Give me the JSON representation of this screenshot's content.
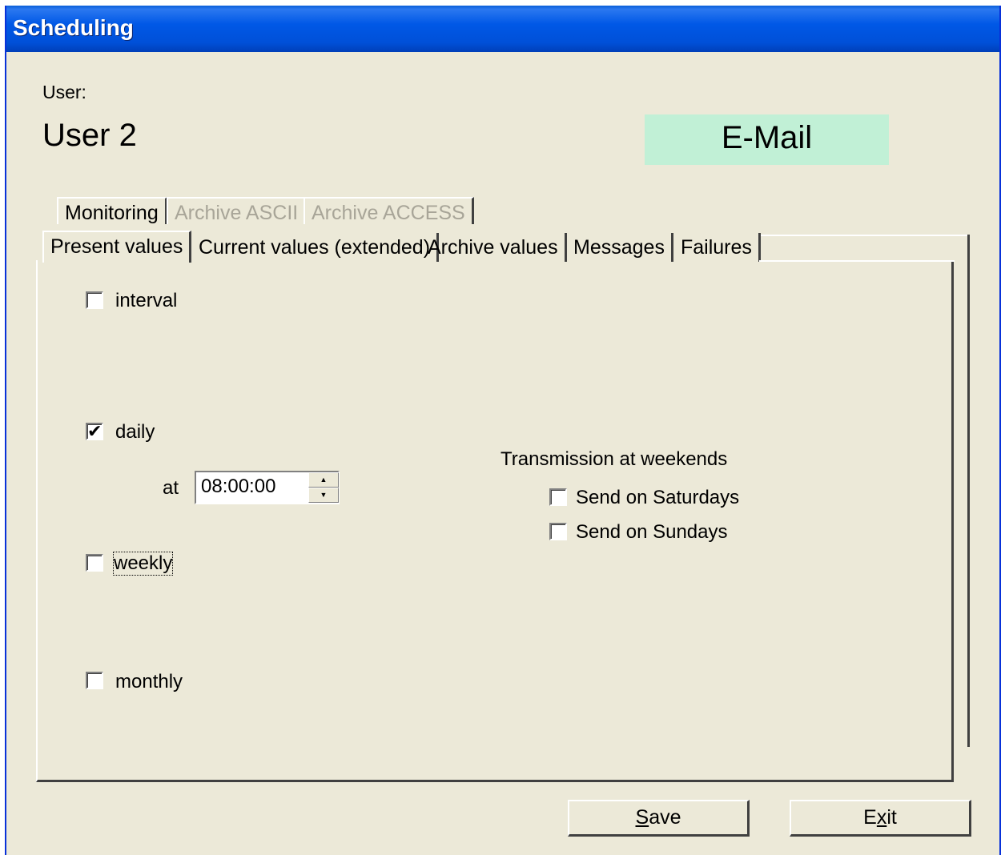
{
  "window": {
    "title": "Scheduling"
  },
  "user": {
    "label": "User:",
    "name": "User 2"
  },
  "channel": {
    "label": "E-Mail",
    "color": "#c1f0d6"
  },
  "tabs_row1": [
    {
      "label": "Monitoring",
      "disabled": false
    },
    {
      "label": "Archive ASCII",
      "disabled": true
    },
    {
      "label": "Archive ACCESS",
      "disabled": true
    }
  ],
  "tabs_row2": [
    {
      "label": "Present values",
      "active": true
    },
    {
      "label": "Current values (extended)"
    },
    {
      "label": "Archive values"
    },
    {
      "label": "Messages"
    },
    {
      "label": "Failures"
    }
  ],
  "schedule": {
    "interval": {
      "label": "interval",
      "checked": false
    },
    "daily": {
      "label": "daily",
      "checked": true,
      "at_label": "at",
      "time": "08:00:00"
    },
    "weekly": {
      "label": "weekly",
      "checked": false
    },
    "monthly": {
      "label": "monthly",
      "checked": false
    }
  },
  "weekends": {
    "title": "Transmission at weekends",
    "saturday": {
      "label": "Send on Saturdays",
      "checked": false
    },
    "sunday": {
      "label": "Send on Sundays",
      "checked": false
    }
  },
  "buttons": {
    "save": {
      "mnemonic": "S",
      "rest": "ave"
    },
    "exit": {
      "pre": "E",
      "mnemonic": "x",
      "rest": "it"
    }
  },
  "checkmark_glyph": "✔"
}
